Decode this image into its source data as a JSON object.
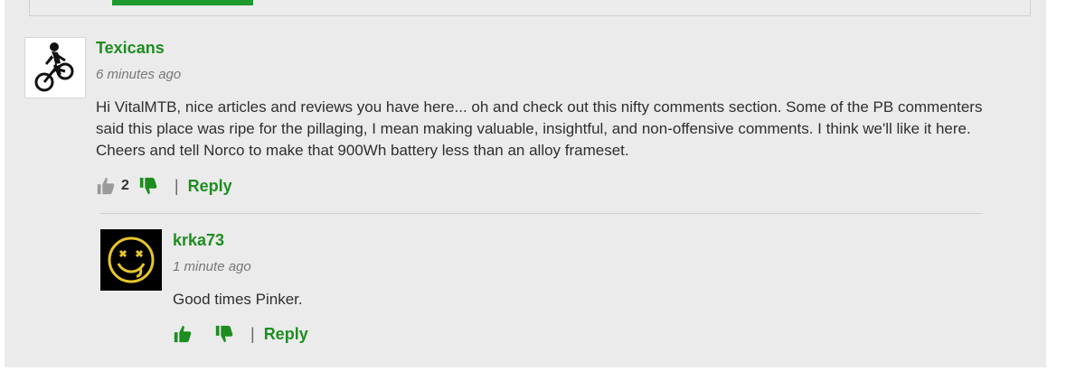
{
  "comments": [
    {
      "username": "Texicans",
      "time": "6 minutes ago",
      "text": "Hi VitalMTB, nice articles and reviews you have here... oh and check out this nifty comments section. Some of the PB commenters said this place was ripe for the pillaging, I mean making valuable, insightful, and non-offensive comments. I think we'll like it here. Cheers and tell Norco to make that 900Wh battery less than an alloy frameset.",
      "upvotes": "2",
      "separator": "|",
      "reply_label": "Reply",
      "avatar_icon": "mountain-biker-silhouette",
      "thumbs_up_color": "#9a9a9a",
      "thumbs_down_color": "#1e8d20"
    },
    {
      "username": "krka73",
      "time": "1 minute ago",
      "text": "Good times Pinker.",
      "upvotes": "",
      "separator": "|",
      "reply_label": "Reply",
      "avatar_icon": "yellow-smiley-face",
      "thumbs_up_color": "#1e8d20",
      "thumbs_down_color": "#1e8d20"
    }
  ],
  "colors": {
    "accent_green": "#1e8d20",
    "panel_bg": "#ebebeb"
  }
}
